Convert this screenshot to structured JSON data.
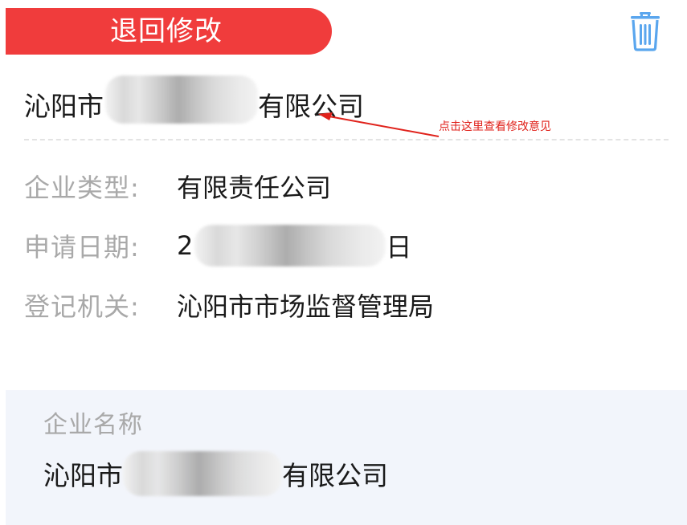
{
  "status": {
    "label": "退回修改",
    "color": "#f03c3c"
  },
  "actions": {
    "delete_icon": "trash-icon",
    "icon_color": "#5aa6ee"
  },
  "company": {
    "name_prefix": "沁阳市",
    "name_suffix": "有限公司"
  },
  "annotation": {
    "text": "点击这里查看修改意见",
    "color": "#e0221b"
  },
  "info": {
    "type_label": "企业类型:",
    "type_value": "有限责任公司",
    "date_label": "申请日期:",
    "date_value_prefix": "2",
    "date_value_suffix": "日",
    "authority_label": "登记机关:",
    "authority_value": "沁阳市市场监督管理局"
  },
  "name_card": {
    "label": "企业名称",
    "value_prefix": "沁阳市",
    "value_suffix": "有限公司"
  }
}
